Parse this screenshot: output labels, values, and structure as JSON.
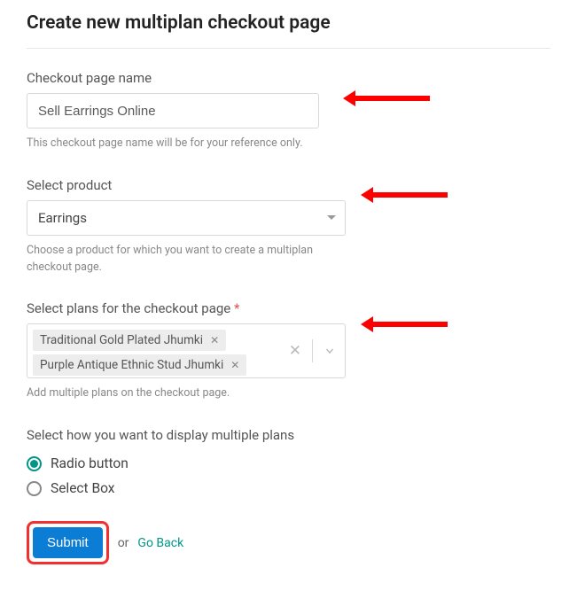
{
  "page": {
    "title": "Create new multiplan checkout page"
  },
  "nameField": {
    "label": "Checkout page name",
    "value": "Sell Earrings Online",
    "help": "This checkout page name will be for your reference only."
  },
  "productField": {
    "label": "Select product",
    "value": "Earrings",
    "help": "Choose a product for which you want to create a multiplan checkout page."
  },
  "plansField": {
    "label": "Select plans for the checkout page",
    "required_mark": "*",
    "tags": [
      "Traditional Gold Plated Jhumki",
      "Purple Antique Ethnic Stud Jhumki"
    ],
    "help": "Add multiple plans on the checkout page."
  },
  "displayField": {
    "label": "Select how you want to display multiple plans",
    "options": [
      {
        "label": "Radio button",
        "checked": true
      },
      {
        "label": "Select Box",
        "checked": false
      }
    ]
  },
  "actions": {
    "submit": "Submit",
    "or": "or",
    "goback": "Go Back"
  }
}
